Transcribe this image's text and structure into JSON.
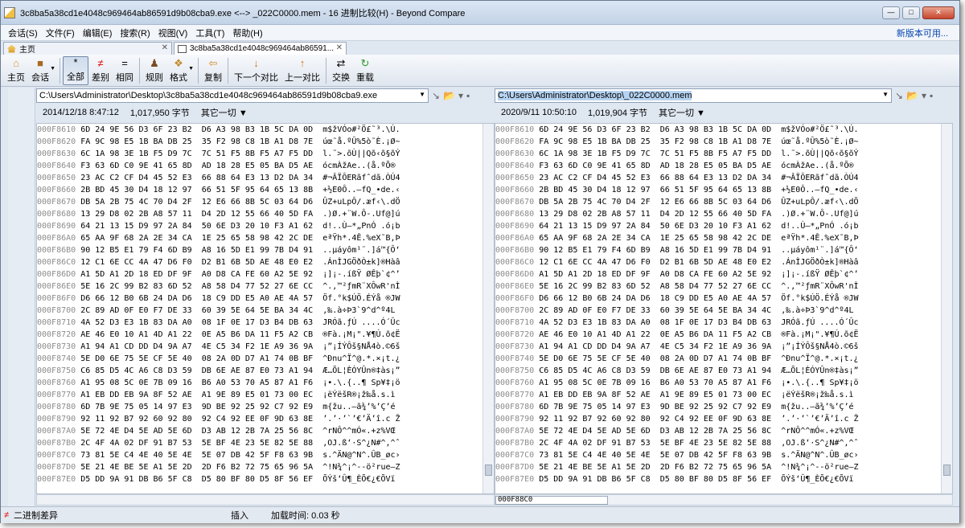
{
  "window": {
    "title": "3c8ba5a38cd1e4048c969464ab86591d9b08cba9.exe <--> _022C0000.mem - 16 进制比较(H) - Beyond Compare"
  },
  "menu": [
    "会话(S)",
    "文件(F)",
    "编辑(E)",
    "搜索(R)",
    "视图(V)",
    "工具(T)",
    "帮助(H)"
  ],
  "new_version": "新版本可用...",
  "tabs": {
    "home": "主页",
    "compare": "3c8ba5a38cd1e4048c969464ab86591..."
  },
  "toolbar": {
    "home": "主页",
    "session": "会话",
    "all": "全部",
    "diff": "差别",
    "same": "相同",
    "rules": "规则",
    "format": "格式",
    "copy": "复制",
    "next": "下一个对比",
    "prev": "上一对比",
    "swap": "交换",
    "reload": "重载"
  },
  "left": {
    "path": "C:\\Users\\Administrator\\Desktop\\3c8ba5a38cd1e4048c969464ab86591d9b08cba9.exe",
    "date": "2014/12/18 8:47:12",
    "size": "1,017,950 字节",
    "other": "其它一切 ▼"
  },
  "right": {
    "path": "C:\\Users\\Administrator\\Desktop\\_022C0000.mem",
    "date": "2020/9/11 10:50:10",
    "size": "1,019,904 字节",
    "other": "其它一切 ▼"
  },
  "rows": [
    [
      "000F8610",
      "6D 24 9E 56 D3 6F 23 B2  D6 A3 98 B3 1B 5C DA 0D",
      "m$žVÓo#²Ö£˜³.\\Ú."
    ],
    [
      "000F8620",
      "FA 9C 98 E5 1B BA DB 25  35 F2 98 C8 1B A1 D8 7E",
      "úœ˜å.ºÛ%5ò˜È.¡Ø~"
    ],
    [
      "000F8630",
      "6C 1A 98 3E 1B F5 D9 7C  7C 51 F5 8B F5 A7 F5 DD",
      "l.˜>.õÙ||Qõ‹õ§õÝ"
    ],
    [
      "000F8640",
      "F3 63 6D C0 9E 41 65 8D  AD 18 28 E5 05 BA D5 AE",
      "ócmÀžAe.­.(å.ºÕ®"
    ],
    [
      "000F8650",
      "23 AC C2 CF D4 45 52 E3  66 88 64 E3 13 D2 DA 34",
      "#¬ÂÏÔERãfˆdã.ÒÚ4"
    ],
    [
      "000F8660",
      "2B BD 45 30 D4 18 12 97  66 51 5F 95 64 65 13 8B",
      "+½E0Ô..—fQ_•de.‹"
    ],
    [
      "000F8670",
      "DB 5A 2B 75 4C 70 D4 2F  12 E6 66 8B 5C 03 64 D6",
      "ÛZ+uLpÔ/.æf‹\\.dÖ"
    ],
    [
      "000F8680",
      "13 29 D8 02 2B A8 57 11  D4 2D 12 55 66 40 5D FA",
      ".)Ø.+¨W.Ô-.Uf@]ú"
    ],
    [
      "000F8690",
      "64 21 13 15 D9 97 2A 84  50 6E D3 20 10 F3 A1 62",
      "d!..Ù—*„PnÓ .ó¡b"
    ],
    [
      "000F86A0",
      "65 AA 9F 68 2A 2E 34 CA  1E 25 65 58 98 42 2C DE",
      "eªŸh*.4Ê.%eX˜B,Þ"
    ],
    [
      "000F86B0",
      "90 12 B5 E1 79 F4 6D B9  A8 16 5D E1 99 7B D4 91",
      "..µáyôm¹¨.]á™{Ô‘"
    ],
    [
      "000F86C0",
      "12 C1 6E CC 4A 47 D6 F0  D2 B1 6B 5D AE 48 E0 E2",
      ".ÁnÌJGÖðÒ±k]®Hàâ"
    ],
    [
      "000F86D0",
      "A1 5D A1 2D 18 ED DF 9F  A0 D8 CA FE 60 A2 5E 92",
      "¡]¡-.íßŸ ØÊþ`¢^’"
    ],
    [
      "000F86E0",
      "5E 16 2C 99 B2 83 6D 52  A8 58 D4 77 52 27 6E CC",
      "^.,™²ƒmR¨XÔwR'nÌ"
    ],
    [
      "000F86F0",
      "D6 66 12 B0 6B 24 DA D6  18 C9 DD E5 A0 AE 4A 57",
      "Öf.°k$ÚÖ.ÉÝå ®JW"
    ],
    [
      "000F8700",
      "2C 89 AD 0F E0 F7 DE 33  60 39 5E 64 5E BA 34 4C",
      ",‰­.à÷Þ3`9^d^º4L"
    ],
    [
      "000F8710",
      "4A 52 D3 E3 1B 83 DA A0  08 1F 0E 17 D3 B4 DB 63",
      "JRÓã.ƒÚ ....Ó´Ûc"
    ],
    [
      "000F8720",
      "AE 46 E0 10 A1 4D A1 22  0E A5 B6 DA 11 F5 A2 CB",
      "®Fà.¡M¡\".¥¶Ú.õ¢Ë"
    ],
    [
      "000F8730",
      "A1 94 A1 CD DD D4 9A A7  4E C5 34 F2 1E A9 36 9A",
      "¡”¡ÍÝÔš§NÅ4ò.©6š"
    ],
    [
      "000F8740",
      "5E D0 6E 75 5E CF 5E 40  08 2A 0D D7 A1 74 0B BF",
      "^Ðnu^Ï^@.*.×¡t.¿"
    ],
    [
      "000F8750",
      "C6 85 D5 4C A6 C8 D3 59  DB 6E AE 87 E0 73 A1 94",
      "Æ…ÕL¦ÈÓYÛn®‡às¡”"
    ],
    [
      "000F8760",
      "A1 95 08 5C 0E 7B 09 16  B6 A0 53 70 A5 87 A1 F6",
      "¡•.\\.{..¶ Sp¥‡¡ö"
    ],
    [
      "000F8770",
      "A1 EB DD EB 9A 8F 52 AE  A1 9E 89 E5 01 73 00 EC",
      "¡ëÝëšR®¡ž‰å.s.ì"
    ],
    [
      "000F8780",
      "6D 7B 9E 75 05 14 97 E3  9D BE 92 25 92 C7 92 E9",
      "m{žu..—ã¾’%’Ç’é"
    ],
    [
      "000F8790",
      "92 11 92 B7 92 60 92 80  92 C4 92 EE 0F 9D 63 8E",
      "’.’·’`’€’Ä’î.c Ž"
    ],
    [
      "000F87A0",
      "5E 72 4E D4 5E AD 5E 6D  D3 AB 12 2B 7A 25 56 8C",
      "^rNÔ^­^mÓ«.+z%VŒ"
    ],
    [
      "000F87B0",
      "2C 4F 4A 02 DF 91 B7 53  5E BF 4E 23 5E 82 5E 88",
      ",OJ.ß‘·S^¿N#^‚^ˆ"
    ],
    [
      "000F87C0",
      "73 81 5E C4 4E 40 5E 4E  5E 07 DB 42 5F F8 63 9B",
      "s.^ÄN@^N^.ÛB_øc›"
    ],
    [
      "000F87D0",
      "5E 21 4E BE 5E A1 5E 2D  2D F6 B2 72 75 65 96 5A",
      "^!N¾^¡^--ö²rue–Z"
    ],
    [
      "000F87E0",
      "D5 DD 9A 91 DB B6 5F C8  D5 80 BF 80 D5 8F 56 EF",
      "ÕÝš‘Û¶_ÈÕ€¿€ÕVï"
    ]
  ],
  "address_box": "000F88C0",
  "status": {
    "mode": "二进制差异",
    "insert": "插入",
    "load_time": "加载时间: 0.03 秒"
  }
}
